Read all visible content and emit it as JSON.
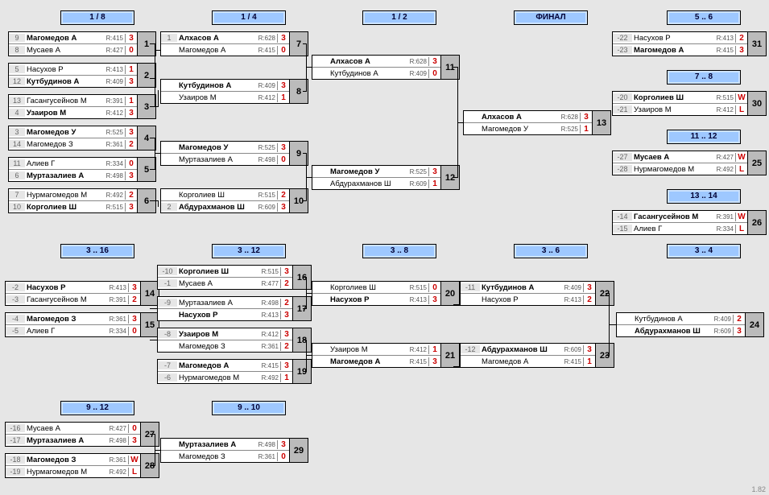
{
  "version": "1.82",
  "headers": {
    "r8": "1 / 8",
    "r4": "1 / 4",
    "r2": "1 / 2",
    "fin": "ФИНАЛ",
    "p56": "5 .. 6",
    "p78": "7 .. 8",
    "p1112": "11 .. 12",
    "p1314": "13 .. 14",
    "p316": "3 .. 16",
    "p312": "3 .. 12",
    "p38": "3 .. 8",
    "p36": "3 .. 6",
    "p34": "3 .. 4",
    "p912": "9 .. 12",
    "p910": "9 .. 10"
  },
  "m": {
    "a1": {
      "id": "1",
      "p1": {
        "s": "9",
        "n": "Магомедов А",
        "r": "R:415",
        "sc": "3",
        "b": 1
      },
      "p2": {
        "s": "8",
        "n": "Мусаев А",
        "r": "R:427",
        "sc": "0"
      }
    },
    "a2": {
      "id": "2",
      "p1": {
        "s": "5",
        "n": "Насухов Р",
        "r": "R:413",
        "sc": "1"
      },
      "p2": {
        "s": "12",
        "n": "Кутбудинов А",
        "r": "R:409",
        "sc": "3",
        "b": 1
      }
    },
    "a3": {
      "id": "3",
      "p1": {
        "s": "13",
        "n": "Гасангусейнов М",
        "r": "R:391",
        "sc": "1"
      },
      "p2": {
        "s": "4",
        "n": "Узаиров М",
        "r": "R:412",
        "sc": "3",
        "b": 1
      }
    },
    "a4": {
      "id": "4",
      "p1": {
        "s": "3",
        "n": "Магомедов У",
        "r": "R:525",
        "sc": "3",
        "b": 1
      },
      "p2": {
        "s": "14",
        "n": "Магомедов З",
        "r": "R:361",
        "sc": "2"
      }
    },
    "a5": {
      "id": "5",
      "p1": {
        "s": "11",
        "n": "Алиев Г",
        "r": "R:334",
        "sc": "0"
      },
      "p2": {
        "s": "6",
        "n": "Муртазалиев А",
        "r": "R:498",
        "sc": "3",
        "b": 1
      }
    },
    "a6": {
      "id": "6",
      "p1": {
        "s": "7",
        "n": "Нурмагомедов М",
        "r": "R:492",
        "sc": "2"
      },
      "p2": {
        "s": "10",
        "n": "Корголиев Ш",
        "r": "R:515",
        "sc": "3",
        "b": 1
      }
    },
    "b7": {
      "id": "7",
      "p1": {
        "s": "1",
        "n": "Алхасов А",
        "r": "R:628",
        "sc": "3",
        "b": 1
      },
      "p2": {
        "s": "",
        "n": "Магомедов А",
        "r": "R:415",
        "sc": "0"
      }
    },
    "b8": {
      "id": "8",
      "p1": {
        "s": "",
        "n": "Кутбудинов А",
        "r": "R:409",
        "sc": "3",
        "b": 1
      },
      "p2": {
        "s": "",
        "n": "Узаиров М",
        "r": "R:412",
        "sc": "1"
      }
    },
    "b9": {
      "id": "9",
      "p1": {
        "s": "",
        "n": "Магомедов У",
        "r": "R:525",
        "sc": "3",
        "b": 1
      },
      "p2": {
        "s": "",
        "n": "Муртазалиев А",
        "r": "R:498",
        "sc": "0"
      }
    },
    "b10": {
      "id": "10",
      "p1": {
        "s": "",
        "n": "Корголиев Ш",
        "r": "R:515",
        "sc": "2"
      },
      "p2": {
        "s": "2",
        "n": "Абдурахманов Ш",
        "r": "R:609",
        "sc": "3",
        "b": 1
      }
    },
    "c11": {
      "id": "11",
      "p1": {
        "s": "",
        "n": "Алхасов А",
        "r": "R:628",
        "sc": "3",
        "b": 1
      },
      "p2": {
        "s": "",
        "n": "Кутбудинов А",
        "r": "R:409",
        "sc": "0"
      }
    },
    "c12": {
      "id": "12",
      "p1": {
        "s": "",
        "n": "Магомедов У",
        "r": "R:525",
        "sc": "3",
        "b": 1
      },
      "p2": {
        "s": "",
        "n": "Абдурахманов Ш",
        "r": "R:609",
        "sc": "1"
      }
    },
    "d13": {
      "id": "13",
      "p1": {
        "s": "",
        "n": "Алхасов А",
        "r": "R:628",
        "sc": "3",
        "b": 1
      },
      "p2": {
        "s": "",
        "n": "Магомедов У",
        "r": "R:525",
        "sc": "1"
      }
    },
    "p31": {
      "id": "31",
      "p1": {
        "s": "-22",
        "n": "Насухов Р",
        "r": "R:413",
        "sc": "2"
      },
      "p2": {
        "s": "-23",
        "n": "Магомедов А",
        "r": "R:415",
        "sc": "3",
        "b": 1
      }
    },
    "p30": {
      "id": "30",
      "p1": {
        "s": "-20",
        "n": "Корголиев Ш",
        "r": "R:515",
        "sc": "W",
        "b": 1
      },
      "p2": {
        "s": "-21",
        "n": "Узаиров М",
        "r": "R:412",
        "sc": "L"
      }
    },
    "p25": {
      "id": "25",
      "p1": {
        "s": "-27",
        "n": "Мусаев А",
        "r": "R:427",
        "sc": "W",
        "b": 1
      },
      "p2": {
        "s": "-28",
        "n": "Нурмагомедов М",
        "r": "R:492",
        "sc": "L"
      }
    },
    "p26": {
      "id": "26",
      "p1": {
        "s": "-14",
        "n": "Гасангусейнов М",
        "r": "R:391",
        "sc": "W",
        "b": 1
      },
      "p2": {
        "s": "-15",
        "n": "Алиев Г",
        "r": "R:334",
        "sc": "L"
      }
    },
    "e14": {
      "id": "14",
      "p1": {
        "s": "-2",
        "n": "Насухов Р",
        "r": "R:413",
        "sc": "3",
        "b": 1
      },
      "p2": {
        "s": "-3",
        "n": "Гасангусейнов М",
        "r": "R:391",
        "sc": "2"
      }
    },
    "e15": {
      "id": "15",
      "p1": {
        "s": "-4",
        "n": "Магомедов З",
        "r": "R:361",
        "sc": "3",
        "b": 1
      },
      "p2": {
        "s": "-5",
        "n": "Алиев Г",
        "r": "R:334",
        "sc": "0"
      }
    },
    "f16": {
      "id": "16",
      "p1": {
        "s": "-10",
        "n": "Корголиев Ш",
        "r": "R:515",
        "sc": "3",
        "b": 1
      },
      "p2": {
        "s": "-1",
        "n": "Мусаев А",
        "r": "R:477",
        "sc": "2"
      }
    },
    "f17": {
      "id": "17",
      "p1": {
        "s": "-9",
        "n": "Муртазалиев А",
        "r": "R:498",
        "sc": "2"
      },
      "p2": {
        "s": "",
        "n": "Насухов Р",
        "r": "R:413",
        "sc": "3",
        "b": 1
      }
    },
    "f18": {
      "id": "18",
      "p1": {
        "s": "-8",
        "n": "Узаиров М",
        "r": "R:412",
        "sc": "3",
        "b": 1
      },
      "p2": {
        "s": "",
        "n": "Магомедов З",
        "r": "R:361",
        "sc": "2"
      }
    },
    "f19": {
      "id": "19",
      "p1": {
        "s": "-7",
        "n": "Магомедов А",
        "r": "R:415",
        "sc": "3",
        "b": 1
      },
      "p2": {
        "s": "-6",
        "n": "Нурмагомедов М",
        "r": "R:492",
        "sc": "1"
      }
    },
    "g20": {
      "id": "20",
      "p1": {
        "s": "",
        "n": "Корголиев Ш",
        "r": "R:515",
        "sc": "0"
      },
      "p2": {
        "s": "",
        "n": "Насухов Р",
        "r": "R:413",
        "sc": "3",
        "b": 1
      }
    },
    "g21": {
      "id": "21",
      "p1": {
        "s": "",
        "n": "Узаиров М",
        "r": "R:412",
        "sc": "1"
      },
      "p2": {
        "s": "",
        "n": "Магомедов А",
        "r": "R:415",
        "sc": "3",
        "b": 1
      }
    },
    "h22": {
      "id": "22",
      "p1": {
        "s": "-11",
        "n": "Кутбудинов А",
        "r": "R:409",
        "sc": "3",
        "b": 1
      },
      "p2": {
        "s": "",
        "n": "Насухов Р",
        "r": "R:413",
        "sc": "2"
      }
    },
    "h23": {
      "id": "23",
      "p1": {
        "s": "-12",
        "n": "Абдурахманов Ш",
        "r": "R:609",
        "sc": "3",
        "b": 1
      },
      "p2": {
        "s": "",
        "n": "Магомедов А",
        "r": "R:415",
        "sc": "1"
      }
    },
    "i24": {
      "id": "24",
      "p1": {
        "s": "",
        "n": "Кутбудинов А",
        "r": "R:409",
        "sc": "2"
      },
      "p2": {
        "s": "",
        "n": "Абдурахманов Ш",
        "r": "R:609",
        "sc": "3",
        "b": 1
      }
    },
    "j27": {
      "id": "27",
      "p1": {
        "s": "-16",
        "n": "Мусаев А",
        "r": "R:427",
        "sc": "0"
      },
      "p2": {
        "s": "-17",
        "n": "Муртазалиев А",
        "r": "R:498",
        "sc": "3",
        "b": 1
      }
    },
    "j28": {
      "id": "28",
      "p1": {
        "s": "-18",
        "n": "Магомедов З",
        "r": "R:361",
        "sc": "W",
        "b": 1
      },
      "p2": {
        "s": "-19",
        "n": "Нурмагомедов М",
        "r": "R:492",
        "sc": "L"
      }
    },
    "k29": {
      "id": "29",
      "p1": {
        "s": "",
        "n": "Муртазалиев А",
        "r": "R:498",
        "sc": "3",
        "b": 1
      },
      "p2": {
        "s": "",
        "n": "Магомедов З",
        "r": "R:361",
        "sc": "0"
      }
    }
  },
  "chart_data": {
    "type": "table",
    "title": "Tournament bracket",
    "rounds": [
      "1/8",
      "1/4",
      "1/2",
      "ФИНАЛ"
    ],
    "placement_brackets": [
      "5..6",
      "7..8",
      "11..12",
      "13..14",
      "3..16",
      "3..12",
      "3..8",
      "3..6",
      "3..4",
      "9..12",
      "9..10"
    ],
    "final": {
      "winner": "Алхасов А",
      "loser": "Магомедов У",
      "score": "3-1"
    },
    "third_place": {
      "winner": "Абдурахманов Ш",
      "loser": "Кутбудинов А",
      "score": "3-2"
    }
  }
}
